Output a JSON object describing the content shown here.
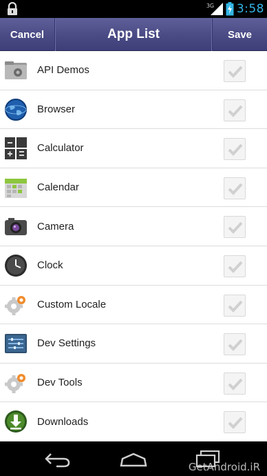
{
  "status_bar": {
    "network": "3G",
    "time": "3:58",
    "icons": [
      "lock-icon",
      "signal-icon",
      "battery-charging-icon"
    ]
  },
  "action_bar": {
    "cancel_label": "Cancel",
    "title": "App List",
    "save_label": "Save"
  },
  "apps": [
    {
      "label": "API Demos",
      "icon": "gear-folder-icon",
      "checked": true
    },
    {
      "label": "Browser",
      "icon": "globe-icon",
      "checked": true
    },
    {
      "label": "Calculator",
      "icon": "calculator-icon",
      "checked": true
    },
    {
      "label": "Calendar",
      "icon": "calendar-icon",
      "checked": true
    },
    {
      "label": "Camera",
      "icon": "camera-icon",
      "checked": true
    },
    {
      "label": "Clock",
      "icon": "clock-icon",
      "checked": true
    },
    {
      "label": "Custom Locale",
      "icon": "gear-icon",
      "checked": true
    },
    {
      "label": "Dev Settings",
      "icon": "dev-settings-icon",
      "checked": true
    },
    {
      "label": "Dev Tools",
      "icon": "gear-icon",
      "checked": true
    },
    {
      "label": "Downloads",
      "icon": "download-icon",
      "checked": true
    }
  ],
  "nav_bar": {
    "icons": [
      "back-icon",
      "home-icon",
      "recent-apps-icon"
    ],
    "watermark": "GetAndroid.iR"
  },
  "colors": {
    "action_bar": "#4a4a85",
    "clock": "#33b5e5",
    "list_background": "#ffffff"
  }
}
